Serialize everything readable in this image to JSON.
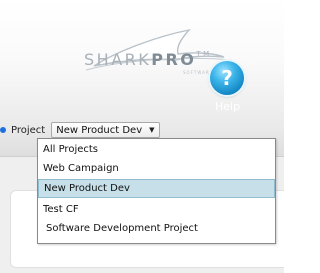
{
  "brand": {
    "logo_main_light": "SHARK",
    "logo_main_bold": "PRO",
    "logo_trademark": "TM",
    "logo_subtitle": "SOFTWARE"
  },
  "help": {
    "icon_glyph": "?",
    "label": "Help"
  },
  "project_selector": {
    "label": "Project",
    "selected_value": "New Product Dev",
    "arrow_glyph": "▼",
    "options": [
      "All Projects",
      "Web Campaign",
      "New Product Dev",
      "Test CF",
      "Software Development Project"
    ],
    "highlighted_option": "New Product Dev"
  },
  "colors": {
    "help_button": "#1a93d1",
    "bullet": "#1e6fe0",
    "highlight_background": "#c6dfe9",
    "highlight_border": "#8fbccf"
  }
}
